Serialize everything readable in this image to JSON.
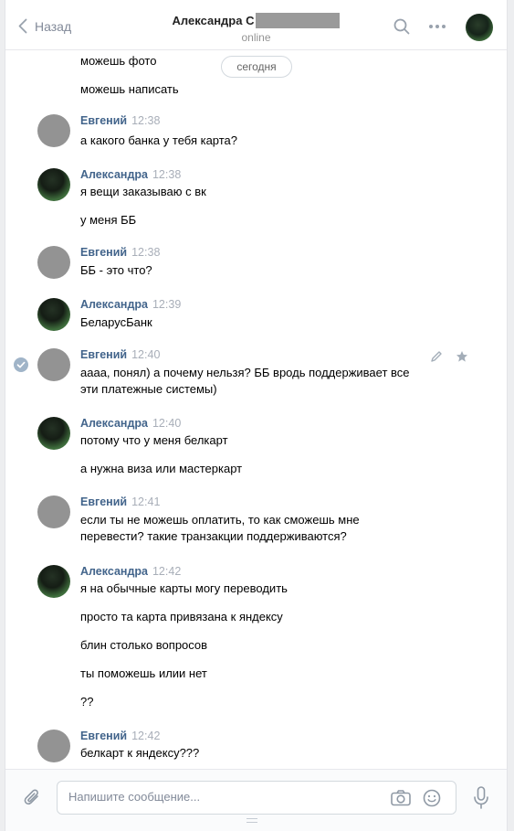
{
  "header": {
    "back_label": "Назад",
    "contact_name": "Александра С",
    "status": "online"
  },
  "chat": {
    "date_divider": "сегодня",
    "continuation_lines": [
      "можешь фото",
      "можешь написать"
    ],
    "messages": [
      {
        "author": "Евгений",
        "time": "12:38",
        "lines": [
          "а какого банка у тебя карта?"
        ]
      },
      {
        "author": "Александра",
        "time": "12:38",
        "lines": [
          "я вещи заказываю с вк",
          "у меня ББ"
        ]
      },
      {
        "author": "Евгений",
        "time": "12:38",
        "lines": [
          "ББ - это что?"
        ]
      },
      {
        "author": "Александра",
        "time": "12:39",
        "lines": [
          "БеларусБанк"
        ]
      },
      {
        "author": "Евгений",
        "time": "12:40",
        "lines": [
          "аааа, понял) а почему нельзя? ББ вродь поддерживает все эти платежные системы)"
        ]
      },
      {
        "author": "Александра",
        "time": "12:40",
        "lines": [
          "потому что у меня белкарт",
          "а нужна виза или мастеркарт"
        ]
      },
      {
        "author": "Евгений",
        "time": "12:41",
        "lines": [
          "если ты не можешь оплатить, то как сможешь мне перевести? такие транзакции поддерживаются?"
        ]
      },
      {
        "author": "Александра",
        "time": "12:42",
        "lines": [
          "я на обычные карты могу переводить",
          "просто та карта привязана к яндексу",
          "блин столько вопросов",
          "ты поможешь илии нет",
          "??"
        ]
      },
      {
        "author": "Евгений",
        "time": "12:42",
        "lines": [
          "белкарт к яндексу???"
        ]
      }
    ]
  },
  "composer": {
    "placeholder": "Напишите сообщение..."
  },
  "icons": {
    "back": "chevron-left-icon",
    "search": "search-icon",
    "more": "more-dots-icon",
    "attach": "paperclip-icon",
    "camera": "camera-icon",
    "emoji": "smile-icon",
    "voice": "microphone-icon",
    "edit": "pencil-icon",
    "favorite": "star-icon",
    "selected": "check-icon"
  },
  "colors": {
    "author": "#42648b",
    "time": "#a8aeb8",
    "gray_avatar": "#939393"
  }
}
